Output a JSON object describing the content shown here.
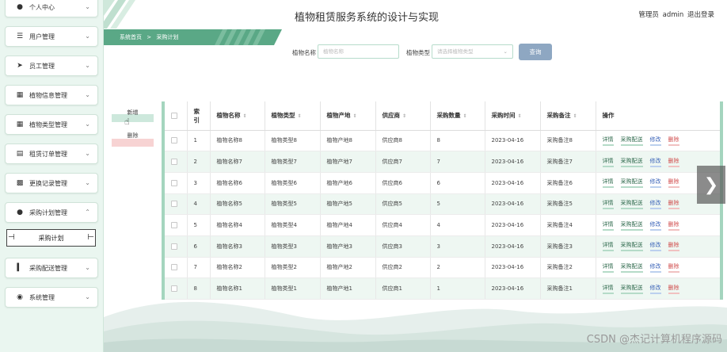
{
  "sidebar": {
    "items": [
      {
        "label": "个人中心",
        "icon": "user-icon"
      },
      {
        "label": "用户管理",
        "icon": "list-icon"
      },
      {
        "label": "员工管理",
        "icon": "send-icon"
      },
      {
        "label": "植物信息管理",
        "icon": "grid-icon"
      },
      {
        "label": "植物类型管理",
        "icon": "grid-icon"
      },
      {
        "label": "租赁订单管理",
        "icon": "doc-icon"
      },
      {
        "label": "更换记录管理",
        "icon": "ticket-icon"
      },
      {
        "label": "采购计划管理",
        "icon": "user-icon"
      },
      {
        "label": "采购配送管理",
        "icon": "bar-chart-icon"
      },
      {
        "label": "系统管理",
        "icon": "location-icon"
      }
    ],
    "active_sub": "采购计划"
  },
  "header": {
    "title": "植物租赁服务系统的设计与实现",
    "role": "管理员",
    "username": "admin",
    "logout": "退出登录"
  },
  "breadcrumb": {
    "home": "系统首页",
    "separator": ">",
    "current": "采购计划"
  },
  "search": {
    "name_label": "植物名称",
    "name_placeholder": "植物名称",
    "type_label": "植物类型",
    "type_placeholder": "请选择植物类型",
    "button": "查询"
  },
  "actions": {
    "add": "新增",
    "delete": "删除"
  },
  "table": {
    "headers": [
      "索引",
      "植物名称",
      "植物类型",
      "植物产地",
      "供应商",
      "采购数量",
      "采购时间",
      "采购备注",
      "操作"
    ],
    "index_header_line1": "索",
    "index_header_line2": "引",
    "row_actions": {
      "detail": "详情",
      "dispatch": "采购配送",
      "edit": "修改",
      "delete": "删除"
    },
    "rows": [
      {
        "index": "1",
        "name": "植物名称8",
        "type": "植物类型8",
        "origin": "植物产地8",
        "supplier": "供应商8",
        "qty": "8",
        "date": "2023-04-16",
        "note": "采购备注8"
      },
      {
        "index": "2",
        "name": "植物名称7",
        "type": "植物类型7",
        "origin": "植物产地7",
        "supplier": "供应商7",
        "qty": "7",
        "date": "2023-04-16",
        "note": "采购备注7"
      },
      {
        "index": "3",
        "name": "植物名称6",
        "type": "植物类型6",
        "origin": "植物产地6",
        "supplier": "供应商6",
        "qty": "6",
        "date": "2023-04-16",
        "note": "采购备注6"
      },
      {
        "index": "4",
        "name": "植物名称5",
        "type": "植物类型5",
        "origin": "植物产地5",
        "supplier": "供应商5",
        "qty": "5",
        "date": "2023-04-16",
        "note": "采购备注5"
      },
      {
        "index": "5",
        "name": "植物名称4",
        "type": "植物类型4",
        "origin": "植物产地4",
        "supplier": "供应商4",
        "qty": "4",
        "date": "2023-04-16",
        "note": "采购备注4"
      },
      {
        "index": "6",
        "name": "植物名称3",
        "type": "植物类型3",
        "origin": "植物产地3",
        "supplier": "供应商3",
        "qty": "3",
        "date": "2023-04-16",
        "note": "采购备注3"
      },
      {
        "index": "7",
        "name": "植物名称2",
        "type": "植物类型2",
        "origin": "植物产地2",
        "supplier": "供应商2",
        "qty": "2",
        "date": "2023-04-16",
        "note": "采购备注2"
      },
      {
        "index": "8",
        "name": "植物名称1",
        "type": "植物类型1",
        "origin": "植物产地1",
        "supplier": "供应商1",
        "qty": "1",
        "date": "2023-04-16",
        "note": "采购备注1"
      }
    ]
  },
  "watermark": "CSDN @杰记计算机程序源码",
  "colors": {
    "accent": "#5aa886",
    "search_button": "#8ea7c2",
    "delete": "#d04c4c",
    "edit": "#3a63b8"
  }
}
